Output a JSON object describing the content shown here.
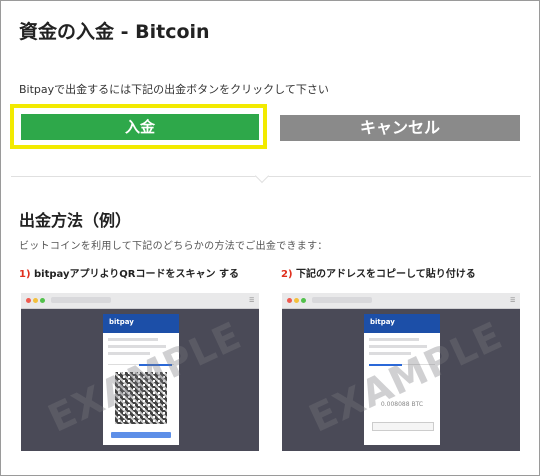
{
  "header": {
    "title": "資金の入金 - Bitcoin"
  },
  "instruction": "Bitpayで出金するには下記の出金ボタンをクリックして下さい",
  "buttons": {
    "deposit": "入金",
    "cancel": "キャンセル"
  },
  "method": {
    "title": "出金方法（例）",
    "description": "ビットコインを利用して下記のどちらかの方法でご出金できます：",
    "steps": [
      {
        "num": "1)",
        "label": "bitpayアプリよりQRコードをスキャン する"
      },
      {
        "num": "2)",
        "label": "下記のアドレスをコピーして貼り付ける"
      }
    ]
  },
  "example": {
    "watermark": "EXAMPLE",
    "logo": "bitpay",
    "amount": "0.008088 BTC"
  },
  "colors": {
    "deposit": "#2ea84a",
    "cancel": "#8a8a8a",
    "highlight": "#f2ea00",
    "step_number": "#e0301e"
  }
}
